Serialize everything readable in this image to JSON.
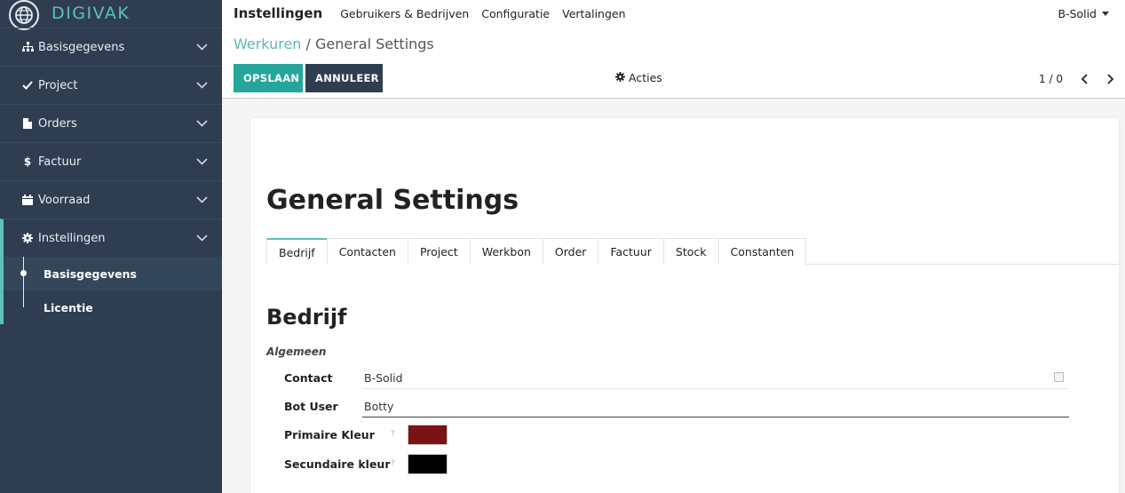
{
  "brand": {
    "name": "DIGIVAK",
    "logo_icon": "globe-icon"
  },
  "sidebar": {
    "items": [
      {
        "label": "Basisgegevens",
        "icon": "sitemap-icon"
      },
      {
        "label": "Project",
        "icon": "check-icon"
      },
      {
        "label": "Orders",
        "icon": "document-icon"
      },
      {
        "label": "Factuur",
        "icon": "dollar-icon"
      },
      {
        "label": "Voorraad",
        "icon": "calendar-icon"
      },
      {
        "label": "Instellingen",
        "icon": "gear-icon"
      }
    ],
    "sub_items": [
      {
        "label": "Basisgegevens"
      },
      {
        "label": "Licentie"
      }
    ]
  },
  "topbar": {
    "app_title": "Instellingen",
    "links": [
      "Gebruikers & Bedrijven",
      "Configuratie",
      "Vertalingen"
    ],
    "company": "B-Solid"
  },
  "control": {
    "breadcrumb_link": "Werkuren",
    "breadcrumb_separator": " / ",
    "breadcrumb_current": "General Settings",
    "save_label": "OPSLAAN",
    "cancel_label": "ANNULEER",
    "actions_label": "Acties",
    "pager": "1 / 0"
  },
  "form": {
    "title": "General Settings",
    "tabs": [
      "Bedrijf",
      "Contacten",
      "Project",
      "Werkbon",
      "Order",
      "Factuur",
      "Stock",
      "Constanten"
    ],
    "active_tab": "Bedrijf",
    "section_title": "Bedrijf",
    "group_label": "Algemeen",
    "fields": {
      "contact": {
        "label": "Contact",
        "value": "B-Solid"
      },
      "bot_user": {
        "label": "Bot User",
        "value": "Botty"
      },
      "primary_color": {
        "label": "Primaire Kleur",
        "help": "?",
        "value": "#7a1414"
      },
      "secondary_color": {
        "label": "Secundaire kleur",
        "help": "?",
        "value": "#000000"
      }
    }
  },
  "colors": {
    "sidebar_bg": "#2e3e50",
    "accent": "#5fc1b6",
    "save_button": "#26a69a"
  }
}
